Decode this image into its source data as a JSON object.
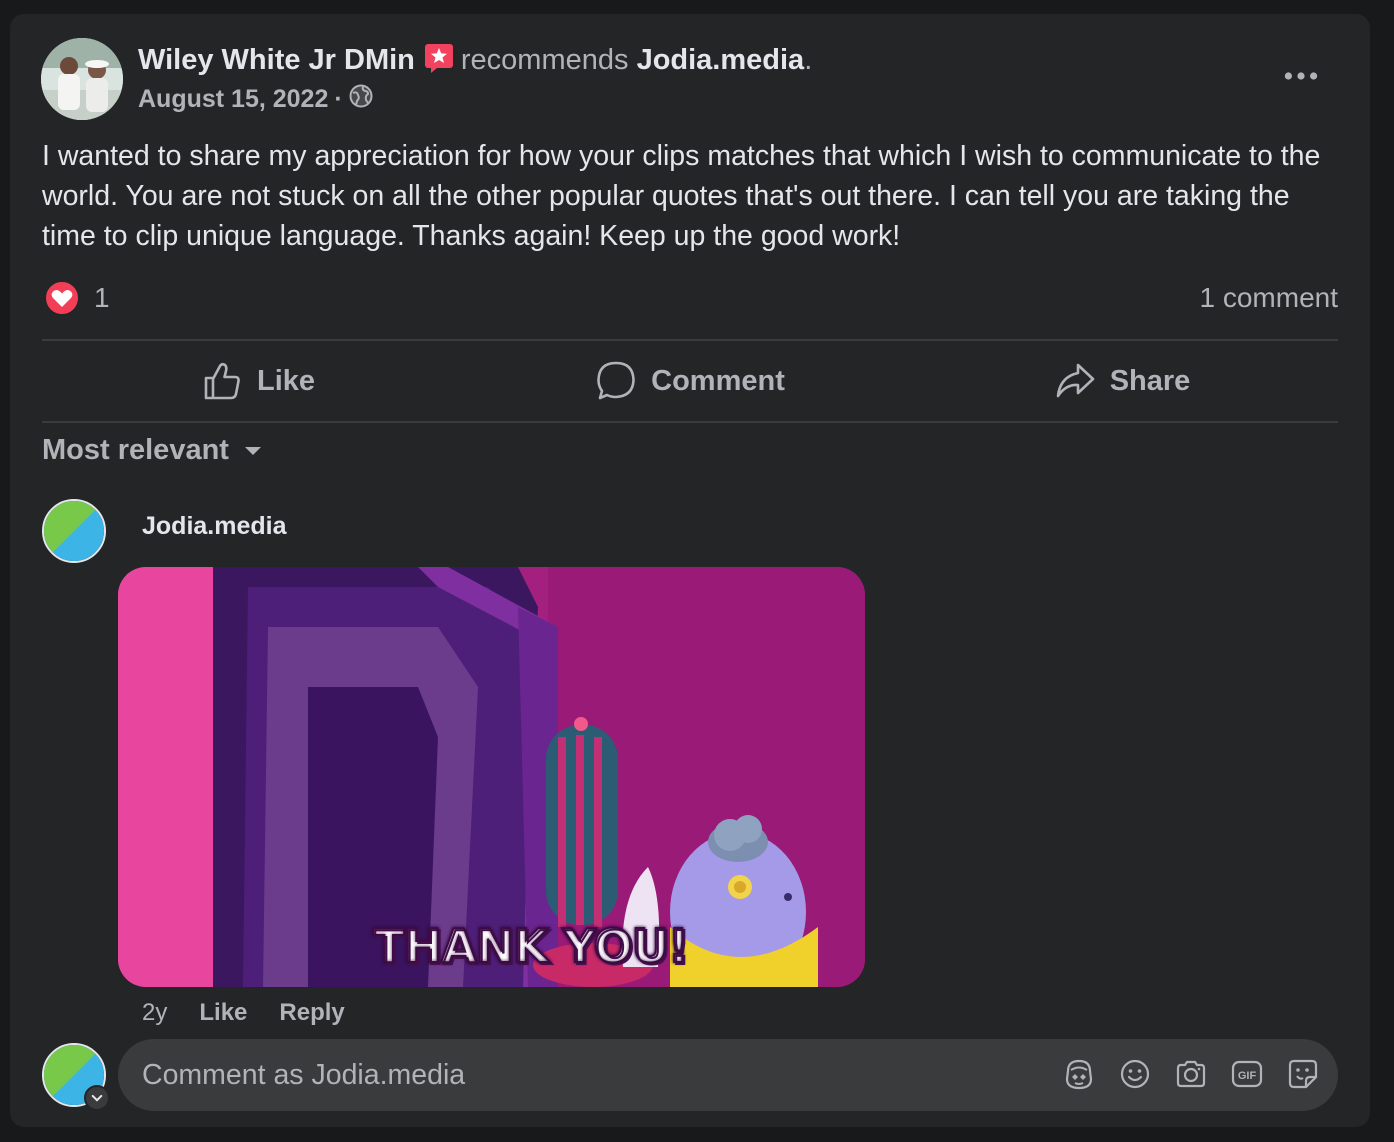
{
  "post": {
    "author_name": "Wiley White Jr DMin",
    "recommend_text": "recommends",
    "page_name": "Jodia.media",
    "period": ".",
    "date": "August 15, 2022",
    "separator": "·",
    "audience_icon": "globe-icon",
    "body": "I wanted to share my appreciation for how your clips matches that which I wish to communicate to the world. You are not stuck on all the other popular quotes that's out there. I can tell you are taking the time to clip unique language. Thanks again! Keep up the good work!",
    "reaction_count": "1",
    "comment_count": "1 comment"
  },
  "actions": {
    "like_label": "Like",
    "comment_label": "Comment",
    "share_label": "Share"
  },
  "comments": {
    "sort_label": "Most relevant",
    "items": [
      {
        "author": "Jodia.media",
        "gif_caption": "THANK YOU!",
        "age": "2y",
        "like_label": "Like",
        "reply_label": "Reply"
      }
    ]
  },
  "composer": {
    "placeholder": "Comment as Jodia.media",
    "tools": [
      "avatar-sticker-icon",
      "emoji-icon",
      "camera-icon",
      "gif-icon",
      "sticker-icon"
    ]
  },
  "colors": {
    "background": "#18191a",
    "card": "#242526",
    "primary_text": "#e4e6eb",
    "secondary_text": "#b0b3b8",
    "love_red": "#f33e58",
    "gif_magenta": "#a01f7c"
  }
}
